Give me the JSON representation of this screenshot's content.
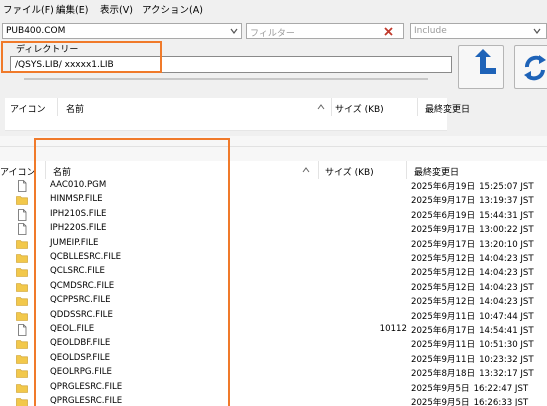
{
  "menu": [
    "ファイル(F)",
    "編集(E)",
    "表示(V)",
    "アクション(A)"
  ],
  "toolbar": {
    "server": "PUB400.COM",
    "filter_placeholder": "フィルター",
    "include_placeholder": "Include"
  },
  "directory": {
    "caption": "ディレクトリー",
    "path": "/QSYS.LIB/ xxxxx1.LIB"
  },
  "columns": {
    "icon": "アイコン",
    "name": "名前",
    "size": "サイズ (KB)",
    "modified": "最終変更日"
  },
  "files": [
    {
      "name": "AAC010.PGM",
      "size": "",
      "date": "2025年6月19日",
      "time": "15:25:07 JST",
      "icon": "document-icon"
    },
    {
      "name": "HINMSP.FILE",
      "size": "",
      "date": "2025年9月17日",
      "time": "13:19:37 JST",
      "icon": "folder-icon"
    },
    {
      "name": "IPH210S.FILE",
      "size": "",
      "date": "2025年6月19日",
      "time": "15:44:31 JST",
      "icon": "document-icon"
    },
    {
      "name": "IPH220S.FILE",
      "size": "",
      "date": "2025年9月17日",
      "time": "13:00:22 JST",
      "icon": "document-icon"
    },
    {
      "name": "JUMEIP.FILE",
      "size": "",
      "date": "2025年9月17日",
      "time": "13:20:10 JST",
      "icon": "folder-icon"
    },
    {
      "name": "QCBLLESRC.FILE",
      "size": "",
      "date": "2025年5月12日",
      "time": "14:04:23 JST",
      "icon": "folder-icon"
    },
    {
      "name": "QCLSRC.FILE",
      "size": "",
      "date": "2025年5月12日",
      "time": "14:04:23 JST",
      "icon": "folder-icon"
    },
    {
      "name": "QCMDSRC.FILE",
      "size": "",
      "date": "2025年5月12日",
      "time": "14:04:23 JST",
      "icon": "folder-icon"
    },
    {
      "name": "QCPPSRC.FILE",
      "size": "",
      "date": "2025年5月12日",
      "time": "14:04:23 JST",
      "icon": "folder-icon"
    },
    {
      "name": "QDDSSRC.FILE",
      "size": "",
      "date": "2025年9月11日",
      "time": "10:47:44 JST",
      "icon": "folder-icon"
    },
    {
      "name": "QEOL.FILE",
      "size": "10112",
      "date": "2025年6月17日",
      "time": "14:54:41 JST",
      "icon": "document-icon"
    },
    {
      "name": "QEOLDBF.FILE",
      "size": "",
      "date": "2025年9月11日",
      "time": "10:51:30 JST",
      "icon": "folder-icon"
    },
    {
      "name": "QEOLDSP.FILE",
      "size": "",
      "date": "2025年9月11日",
      "time": "10:23:32 JST",
      "icon": "folder-icon"
    },
    {
      "name": "QEOLRPG.FILE",
      "size": "",
      "date": "2025年8月18日",
      "time": "13:32:17 JST",
      "icon": "folder-icon"
    },
    {
      "name": "QPRGLESRC.FILE",
      "size": "",
      "date": "2025年9月5日",
      "time": "16:22:47 JST",
      "icon": "folder-icon"
    },
    {
      "name": "QPRGLESRC.FILE",
      "size": "",
      "date": "2025年9月5日",
      "time": "16:26:33 JST",
      "icon": "folder-icon"
    }
  ],
  "colors": {
    "highlight": "#f07a2a",
    "folder": "#f2c84b",
    "arrow": "#1e63b8"
  }
}
